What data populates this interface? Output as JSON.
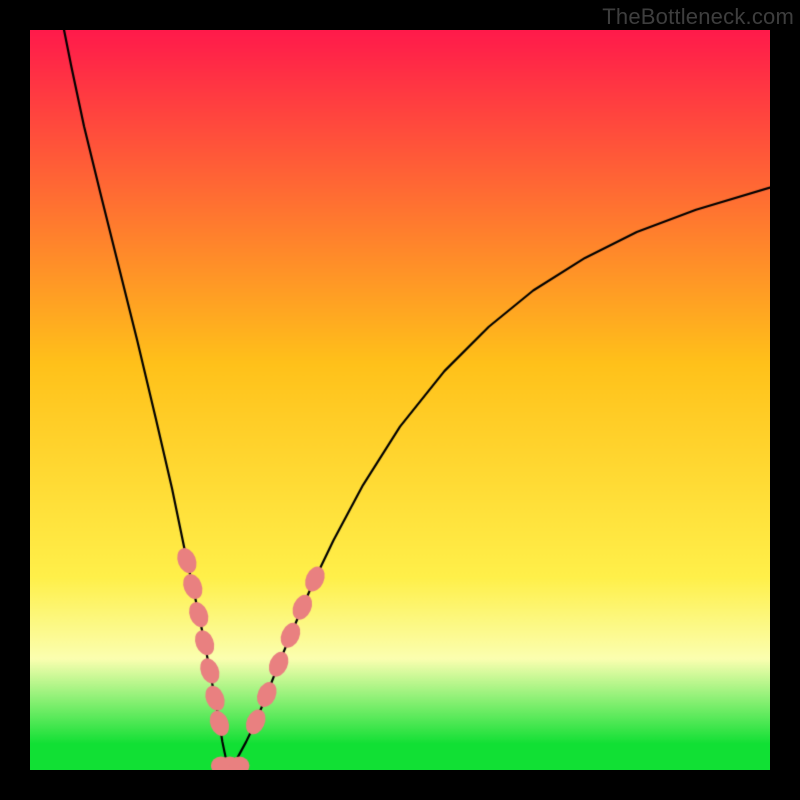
{
  "watermark": "TheBottleneck.com",
  "colors": {
    "top": "#ff1a4b",
    "mid": "#ffc11a",
    "yellow": "#fff04a",
    "pale": "#fbffb0",
    "green": "#11e034",
    "border": "#000000",
    "curve": "#000000",
    "marker": "#e98080"
  },
  "gradient_stops": [
    {
      "p": 0.0,
      "k": "top"
    },
    {
      "p": 0.45,
      "k": "mid"
    },
    {
      "p": 0.74,
      "k": "yellow"
    },
    {
      "p": 0.85,
      "k": "pale"
    },
    {
      "p": 0.965,
      "k": "green"
    }
  ],
  "chart_data": {
    "type": "line",
    "title": "",
    "xlabel": "",
    "ylabel": "",
    "xlim": [
      0,
      100
    ],
    "ylim": [
      0,
      100
    ],
    "legend": null,
    "annotations": [],
    "curve_min_x": 26.7,
    "left_curve": [
      {
        "x": 4.6,
        "y": 100.0
      },
      {
        "x": 5.6,
        "y": 95.0
      },
      {
        "x": 7.3,
        "y": 87.0
      },
      {
        "x": 9.5,
        "y": 78.0
      },
      {
        "x": 12.0,
        "y": 68.0
      },
      {
        "x": 14.5,
        "y": 58.0
      },
      {
        "x": 17.0,
        "y": 47.5
      },
      {
        "x": 19.2,
        "y": 38.0
      },
      {
        "x": 21.2,
        "y": 28.3
      },
      {
        "x": 22.0,
        "y": 24.8
      },
      {
        "x": 22.8,
        "y": 21.0
      },
      {
        "x": 23.6,
        "y": 17.2
      },
      {
        "x": 24.3,
        "y": 13.4
      },
      {
        "x": 25.0,
        "y": 9.7
      },
      {
        "x": 25.6,
        "y": 6.3
      },
      {
        "x": 26.0,
        "y": 3.8
      },
      {
        "x": 26.5,
        "y": 1.4
      },
      {
        "x": 26.7,
        "y": 0.0
      }
    ],
    "right_curve": [
      {
        "x": 26.7,
        "y": 0.0
      },
      {
        "x": 27.9,
        "y": 1.4
      },
      {
        "x": 29.2,
        "y": 3.8
      },
      {
        "x": 30.5,
        "y": 6.5
      },
      {
        "x": 32.0,
        "y": 10.2
      },
      {
        "x": 33.6,
        "y": 14.3
      },
      {
        "x": 35.2,
        "y": 18.2
      },
      {
        "x": 36.8,
        "y": 22.0
      },
      {
        "x": 38.5,
        "y": 25.8
      },
      {
        "x": 41.0,
        "y": 31.0
      },
      {
        "x": 45.0,
        "y": 38.5
      },
      {
        "x": 50.0,
        "y": 46.4
      },
      {
        "x": 56.0,
        "y": 53.9
      },
      {
        "x": 62.0,
        "y": 59.9
      },
      {
        "x": 68.0,
        "y": 64.8
      },
      {
        "x": 75.0,
        "y": 69.2
      },
      {
        "x": 82.0,
        "y": 72.7
      },
      {
        "x": 90.0,
        "y": 75.7
      },
      {
        "x": 100.0,
        "y": 78.7
      }
    ],
    "markers_left": [
      {
        "x": 21.2,
        "y": 28.3
      },
      {
        "x": 22.0,
        "y": 24.8
      },
      {
        "x": 22.8,
        "y": 21.0
      },
      {
        "x": 23.6,
        "y": 17.2
      },
      {
        "x": 24.3,
        "y": 13.4
      },
      {
        "x": 25.0,
        "y": 9.7
      },
      {
        "x": 25.6,
        "y": 6.3
      }
    ],
    "markers_right": [
      {
        "x": 30.5,
        "y": 6.5
      },
      {
        "x": 32.0,
        "y": 10.2
      },
      {
        "x": 33.6,
        "y": 14.3
      },
      {
        "x": 35.2,
        "y": 18.2
      },
      {
        "x": 36.8,
        "y": 22.0
      },
      {
        "x": 38.5,
        "y": 25.8
      }
    ],
    "baseline_markers": [
      {
        "x": 25.8,
        "y": 0.6
      },
      {
        "x": 27.0,
        "y": 0.6
      },
      {
        "x": 28.3,
        "y": 0.6
      }
    ]
  }
}
